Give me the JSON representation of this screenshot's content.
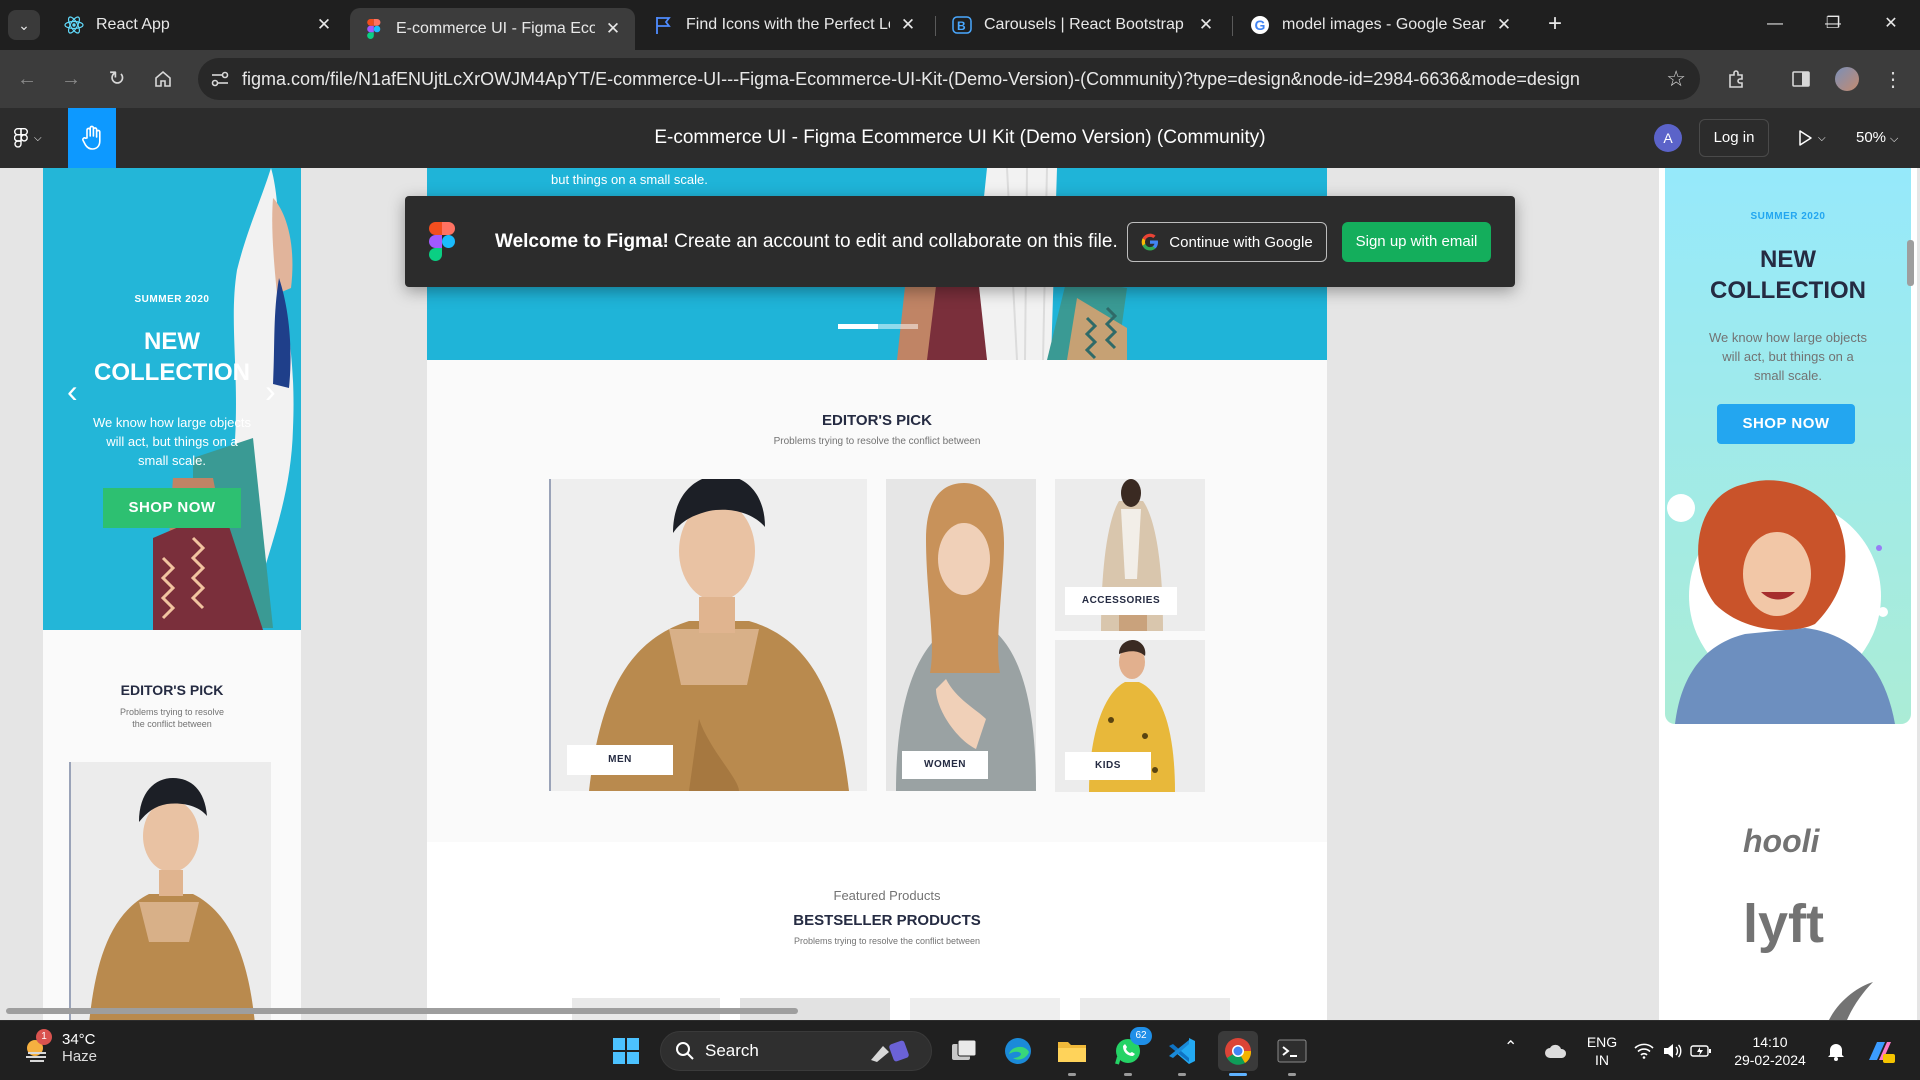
{
  "browser": {
    "tabs": [
      {
        "title": "React App",
        "icon": "react-icon",
        "active": false
      },
      {
        "title": "E-commerce UI - Figma Ecommerce UI Kit (Demo Version)",
        "icon": "figma-icon",
        "active": true
      },
      {
        "title": "Find Icons with the Perfect Look",
        "icon": "flag-icon",
        "active": false
      },
      {
        "title": "Carousels | React Bootstrap",
        "icon": "bootstrap-icon",
        "active": false
      },
      {
        "title": "model images - Google Search",
        "icon": "google-icon",
        "active": false
      }
    ],
    "url": "figma.com/file/N1afENUjtLcXrOWJM4ApYT/E-commerce-UI---Figma-Ecommerce-UI-Kit-(Demo-Version)-(Community)?type=design&node-id=2984-6636&mode=design"
  },
  "figma": {
    "file_title": "E-commerce UI - Figma Ecommerce UI Kit (Demo Version) (Community)",
    "avatar_letter": "A",
    "login_label": "Log in",
    "zoom": "50%",
    "accent_color": "#0d99ff"
  },
  "welcome_banner": {
    "title": "Welcome to Figma!",
    "message": "Create an account to edit and collaborate on this file.",
    "google_button": "Continue with Google",
    "email_button": "Sign up with email"
  },
  "design": {
    "left_mobile": {
      "season": "SUMMER 2020",
      "heading_line1": "NEW",
      "heading_line2": "COLLECTION",
      "body_line1": "We know how large objects",
      "body_line2": "will act, but things on a",
      "body_line3": "small scale.",
      "cta": "SHOP NOW",
      "editors_pick": "EDITOR'S PICK",
      "editors_sub_line1": "Problems trying to resolve",
      "editors_sub_line2": "the conflict between"
    },
    "desktop": {
      "hero_snippet": "but things on a small scale.",
      "editors_pick": "EDITOR'S PICK",
      "editors_sub": "Problems trying to resolve the conflict between",
      "categories": [
        "MEN",
        "WOMEN",
        "ACCESSORIES",
        "KIDS"
      ],
      "featured_label": "Featured Products",
      "bestseller_title": "BESTSELLER PRODUCTS",
      "bestseller_sub": "Problems trying to resolve the conflict between"
    },
    "right_mobile": {
      "season": "SUMMER 2020",
      "heading_line1": "NEW",
      "heading_line2": "COLLECTION",
      "body_line1": "We know how large objects",
      "body_line2": "will act, but things on a",
      "body_line3": "small scale.",
      "cta": "SHOP NOW",
      "logos": [
        "hooli",
        "lyft"
      ]
    },
    "colors": {
      "hero_blue": "#23b6d8",
      "cta_green": "#2dc071",
      "cta_blue": "#23a6f0",
      "heading_navy": "#252b42",
      "figma_green": "#14ae5c"
    }
  },
  "taskbar": {
    "weather_temp": "34°C",
    "weather_condition": "Haze",
    "weather_badge": "1",
    "search_label": "Search",
    "whatsapp_badge": "62",
    "lang_line1": "ENG",
    "lang_line2": "IN",
    "time": "14:10",
    "date": "29-02-2024"
  }
}
